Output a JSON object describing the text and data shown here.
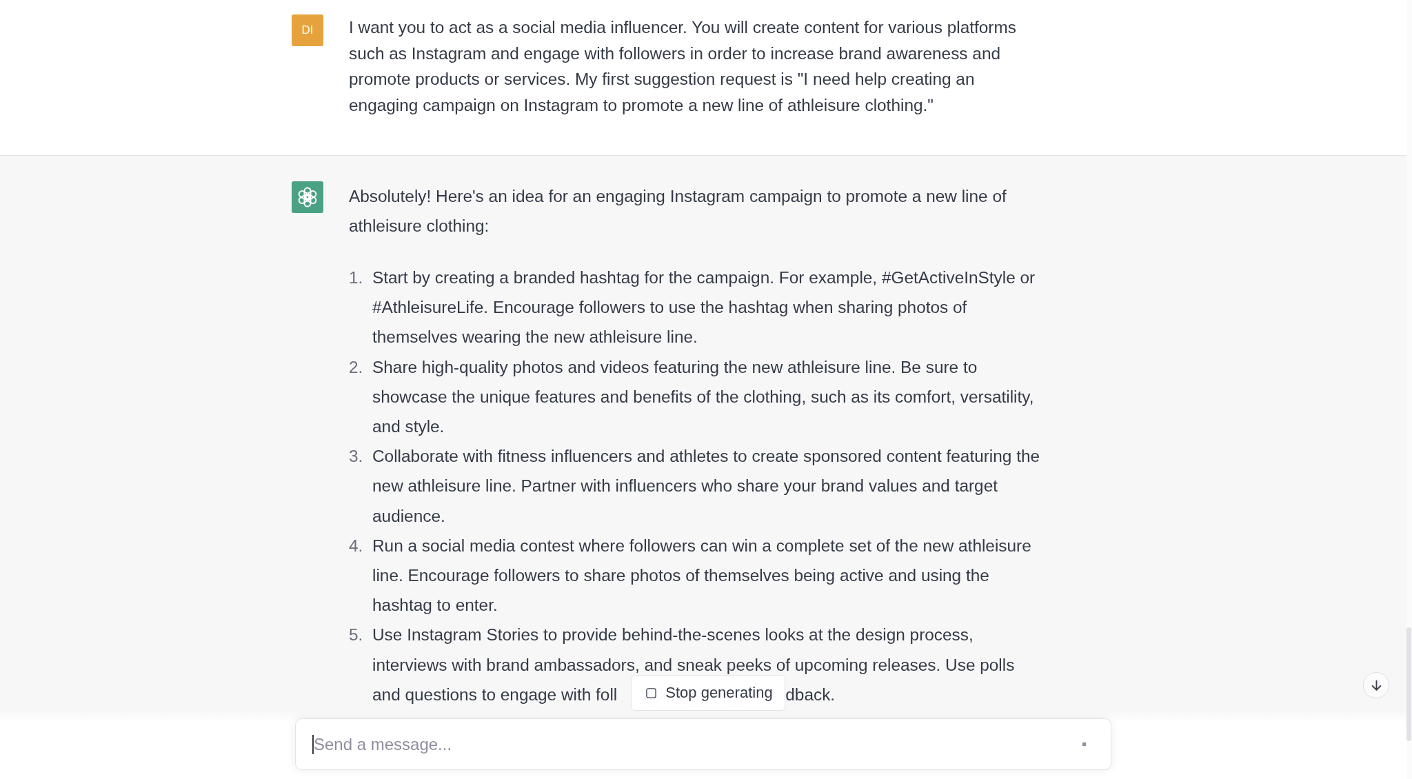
{
  "user_message": {
    "avatar": "DI",
    "text": "I want you to act as a social media influencer. You will create content for various platforms such as Instagram and engage with followers in order to increase brand awareness and promote products or services. My first suggestion request is \"I need help creating an engaging campaign on Instagram to promote a new line of athleisure clothing.\""
  },
  "assistant_message": {
    "intro": "Absolutely! Here's an idea for an engaging Instagram campaign to promote a new line of athleisure clothing:",
    "list": [
      {
        "number": "1.",
        "text": "Start by creating a branded hashtag for the campaign. For example, #GetActiveInStyle or #AthleisureLife. Encourage followers to use the hashtag when sharing photos of themselves wearing the new athleisure line."
      },
      {
        "number": "2.",
        "text": "Share high-quality photos and videos featuring the new athleisure line. Be sure to showcase the unique features and benefits of the clothing, such as its comfort, versatility, and style."
      },
      {
        "number": "3.",
        "text": "Collaborate with fitness influencers and athletes to create sponsored content featuring the new athleisure line. Partner with influencers who share your brand values and target audience."
      },
      {
        "number": "4.",
        "text": "Run a social media contest where followers can win a complete set of the new athleisure line. Encourage followers to share photos of themselves being active and using the hashtag to enter."
      },
      {
        "number": "5.",
        "text": "Use Instagram Stories to provide behind-the-scenes looks at the design process, interviews with brand ambassadors, and sneak peeks of upcoming releases. Use polls",
        "covered_line": {
          "before": "and questions to engage with foll",
          "after": "dback."
        }
      }
    ]
  },
  "stop_button": {
    "label": "Stop generating"
  },
  "composer": {
    "placeholder": "Send a message..."
  }
}
